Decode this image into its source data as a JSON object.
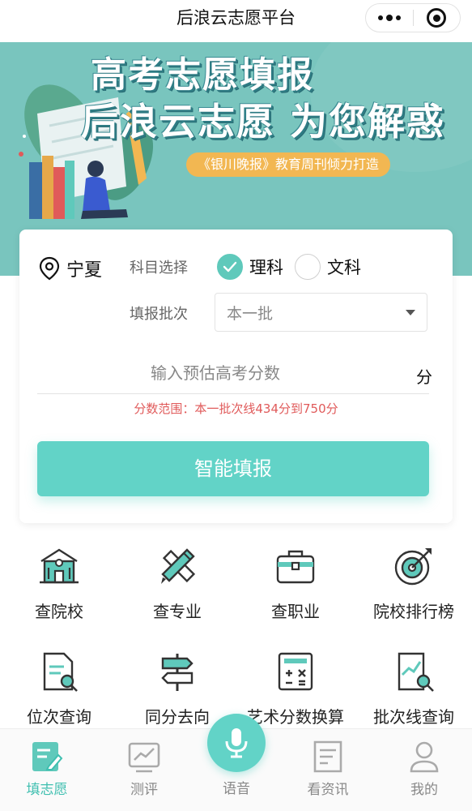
{
  "nav": {
    "title": "后浪云志愿平台"
  },
  "banner": {
    "line1": "高考志愿填报",
    "line2": "后浪云志愿 为您解惑",
    "ribbon": "《银川晚报》教育周刊倾力打造"
  },
  "form": {
    "location": "宁夏",
    "subject_label": "科目选择",
    "subject_options": [
      "理科",
      "文科"
    ],
    "subject_selected": "理科",
    "batch_label": "填报批次",
    "batch_value": "本一批",
    "score_placeholder": "输入预估高考分数",
    "score_unit": "分",
    "score_range_hint": "分数范围：本一批次线434分到750分",
    "submit_label": "智能填报"
  },
  "features": [
    {
      "label": "查院校",
      "icon": "school-building-icon"
    },
    {
      "label": "查专业",
      "icon": "pencil-ruler-icon"
    },
    {
      "label": "查职业",
      "icon": "briefcase-icon"
    },
    {
      "label": "院校排行榜",
      "icon": "target-icon"
    },
    {
      "label": "位次查询",
      "icon": "document-search-icon"
    },
    {
      "label": "同分去向",
      "icon": "signpost-icon"
    },
    {
      "label": "艺术分数换算",
      "icon": "calculator-icon"
    },
    {
      "label": "批次线查询",
      "icon": "chart-search-icon"
    }
  ],
  "tabs": [
    {
      "label": "填志愿",
      "icon": "edit-form-icon",
      "active": true
    },
    {
      "label": "测评",
      "icon": "line-chart-icon",
      "active": false
    },
    {
      "label": "语音",
      "icon": "microphone-icon",
      "active": false
    },
    {
      "label": "看资讯",
      "icon": "news-icon",
      "active": false
    },
    {
      "label": "我的",
      "icon": "user-icon",
      "active": false
    }
  ],
  "colors": {
    "accent": "#62d3c7",
    "banner_bg": "#79c5be",
    "ribbon": "#f2b752",
    "hint": "#e05a5a"
  }
}
